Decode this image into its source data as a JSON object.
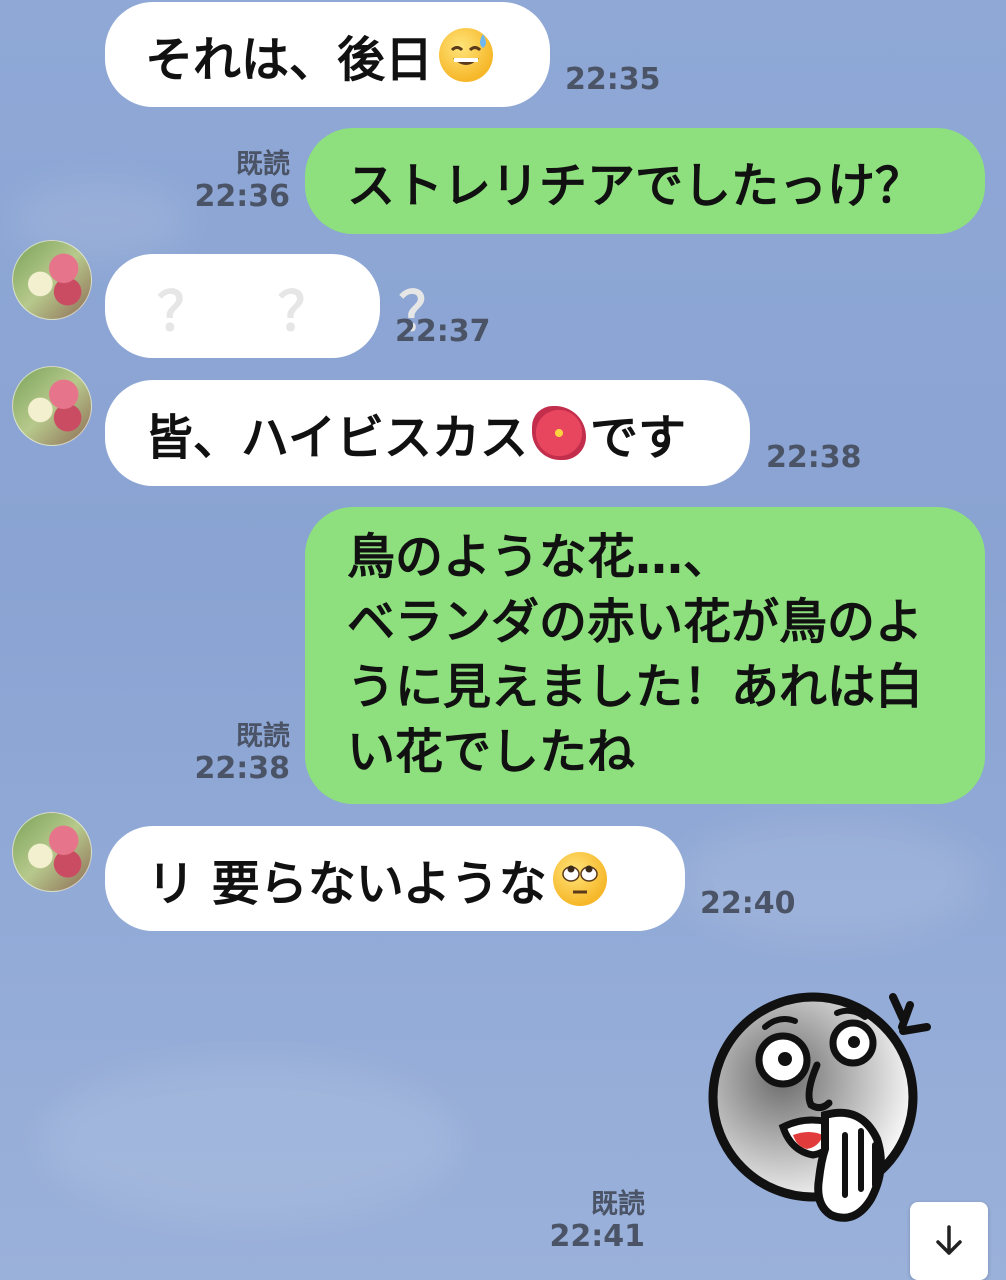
{
  "messages": [
    {
      "side": "in",
      "text": "それは、後日",
      "emoji": "sweat-smile-emoji",
      "time": "22:35"
    },
    {
      "side": "out",
      "text": "ストレリチアでしたっけ？",
      "read": "既読",
      "time": "22:36"
    },
    {
      "side": "in",
      "text": "？  ？  ？",
      "time": "22:37"
    },
    {
      "side": "in",
      "text_before": "皆、ハイビスカス",
      "emoji": "hibiscus-emoji",
      "text_after": "です",
      "time": "22:38"
    },
    {
      "side": "out",
      "lines": [
        "鳥のような花…、",
        "ベランダの赤い花が鳥のよ",
        "うに見えました！あれは白",
        "い花でしたね"
      ],
      "read": "既読",
      "time": "22:38"
    },
    {
      "side": "in",
      "text": "リ  要らないような",
      "emoji": "rolling-eyes-emoji",
      "time": "22:40"
    },
    {
      "side": "out",
      "sticker": "shocked-face-sticker",
      "read": "既読",
      "time": "22:41"
    }
  ],
  "scroll_button_icon": "arrow-down-icon"
}
